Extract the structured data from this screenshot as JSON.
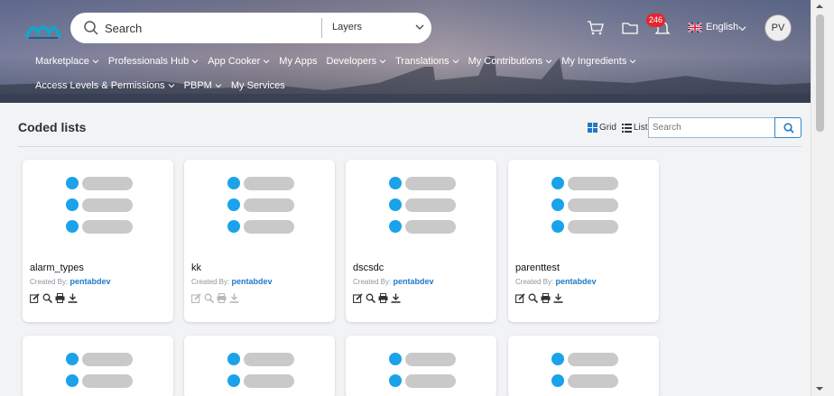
{
  "header": {
    "search_label": "Search",
    "layers_label": "Layers",
    "notification_count": "246",
    "language": "English",
    "avatar_initials": "PV"
  },
  "nav": {
    "row1": [
      {
        "label": "Marketplace",
        "dropdown": true
      },
      {
        "label": "Professionals Hub",
        "dropdown": true
      },
      {
        "label": "App Cooker",
        "dropdown": true
      },
      {
        "label": "My Apps",
        "dropdown": false
      },
      {
        "label": "Developers",
        "dropdown": true
      },
      {
        "label": "Translations",
        "dropdown": true
      },
      {
        "label": "My Contributions",
        "dropdown": true
      },
      {
        "label": "My Ingredients",
        "dropdown": true
      }
    ],
    "row2": [
      {
        "label": "Access Levels & Permissions",
        "dropdown": true
      },
      {
        "label": "PBPM",
        "dropdown": true
      },
      {
        "label": "My Services",
        "dropdown": false
      }
    ]
  },
  "page": {
    "title": "Coded lists",
    "grid_label": "Grid",
    "list_label": "List",
    "search_placeholder": "Search"
  },
  "cards": [
    {
      "name": "alarm_types",
      "created_by_label": "Created By:",
      "author": "pentabdev",
      "actions_enabled": true
    },
    {
      "name": "kk",
      "created_by_label": "Created By:",
      "author": "pentabdev",
      "actions_enabled": false
    },
    {
      "name": "dscsdc",
      "created_by_label": "Created By:",
      "author": "pentabdev",
      "actions_enabled": true
    },
    {
      "name": "parenttest",
      "created_by_label": "Created By:",
      "author": "pentabdev",
      "actions_enabled": true
    }
  ],
  "colors": {
    "accent": "#1f7ac7",
    "bullet": "#1aa3ea",
    "placeholder_bar": "#c9c9c9",
    "badge": "#e3262f"
  },
  "icons": [
    "logo-icon",
    "search-icon",
    "chevron-down-icon",
    "cart-icon",
    "folder-icon",
    "bell-icon",
    "uk-flag-icon",
    "grid-icon",
    "list-icon",
    "edit-icon",
    "view-icon",
    "print-icon",
    "download-icon"
  ]
}
